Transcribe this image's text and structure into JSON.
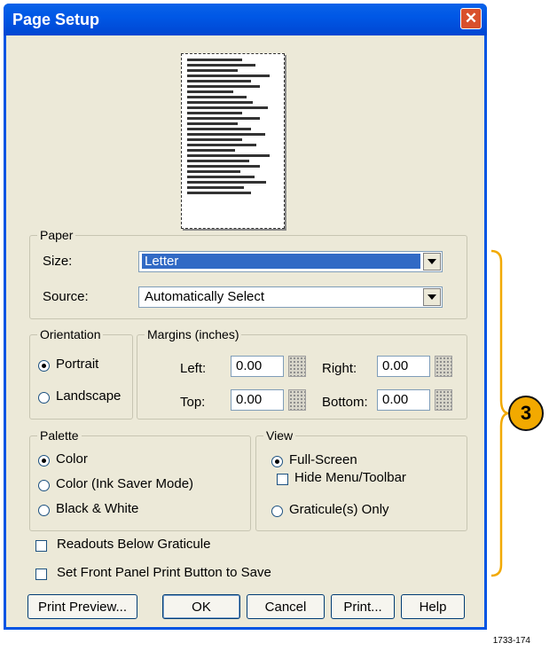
{
  "window": {
    "title": "Page Setup",
    "close_glyph": "✕"
  },
  "paper": {
    "legend": "Paper",
    "size_label": "Size:",
    "size_value": "Letter",
    "source_label": "Source:",
    "source_value": "Automatically Select"
  },
  "orientation": {
    "legend": "Orientation",
    "portrait": "Portrait",
    "landscape": "Landscape",
    "selected": "Portrait"
  },
  "margins": {
    "legend": "Margins (inches)",
    "left_label": "Left:",
    "left": "0.00",
    "right_label": "Right:",
    "right": "0.00",
    "top_label": "Top:",
    "top": "0.00",
    "bottom_label": "Bottom:",
    "bottom": "0.00"
  },
  "palette": {
    "legend": "Palette",
    "color": "Color",
    "ink_saver": "Color (Ink Saver Mode)",
    "bw": "Black & White",
    "selected": "Color"
  },
  "view": {
    "legend": "View",
    "full_screen": "Full-Screen",
    "hide_menu": "Hide Menu/Toolbar",
    "graticule_only": "Graticule(s) Only",
    "selected": "Full-Screen"
  },
  "options": {
    "readouts_below": "Readouts Below Graticule",
    "set_front_panel": "Set Front Panel Print Button to Save"
  },
  "buttons": {
    "print_preview": "Print Preview...",
    "ok": "OK",
    "cancel": "Cancel",
    "print": "Print...",
    "help": "Help"
  },
  "callout": {
    "number": "3",
    "color": "#f2a900"
  },
  "figure_code": "1733-174"
}
